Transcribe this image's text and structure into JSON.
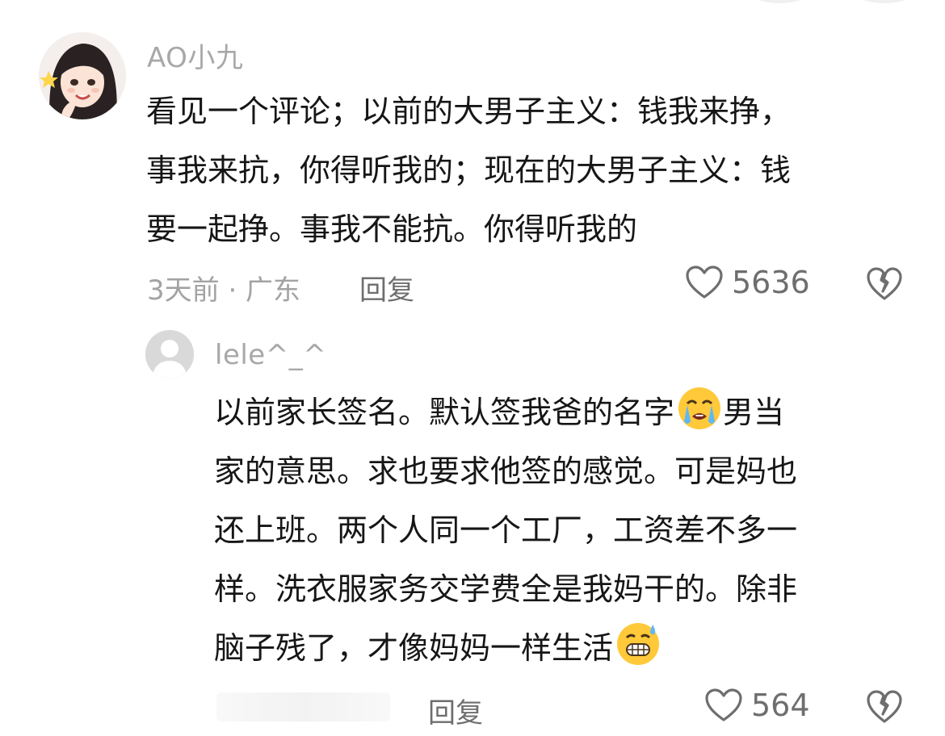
{
  "comments": [
    {
      "username": "AO小九",
      "lines": [
        "看见一个评论；以前的大男子主义：钱我来挣，",
        "事我来抗，你得听我的；现在的大男子主义：钱",
        "要一起挣。事我不能抗。你得听我的"
      ],
      "meta": "3天前 · 广东",
      "reply_label": "回复",
      "likes": "5636",
      "avatar": "user-photo-avatar"
    },
    {
      "username": "lele^_^",
      "lines": [
        "以前家长签名。默认签我爸的名字",
        "男当",
        "家的意思。求也要求他签的感觉。可是妈也",
        "还上班。两个人同一个工厂，工资差不多一",
        "样。洗衣服家务交学费全是我妈干的。除非",
        "脑子残了，才像妈妈一样生活"
      ],
      "reply_label": "回复",
      "likes": "564",
      "avatar": "default-avatar",
      "emojis": [
        "crying-face-emoji",
        "grimacing-sweat-emoji"
      ]
    }
  ],
  "icons": {
    "like": "heart-outline-icon",
    "dislike": "broken-heart-icon"
  },
  "colors": {
    "text": "#161616",
    "muted": "#a3a3a3",
    "action": "#6e6e6e",
    "emoji_yellow": "#ffc93a"
  }
}
